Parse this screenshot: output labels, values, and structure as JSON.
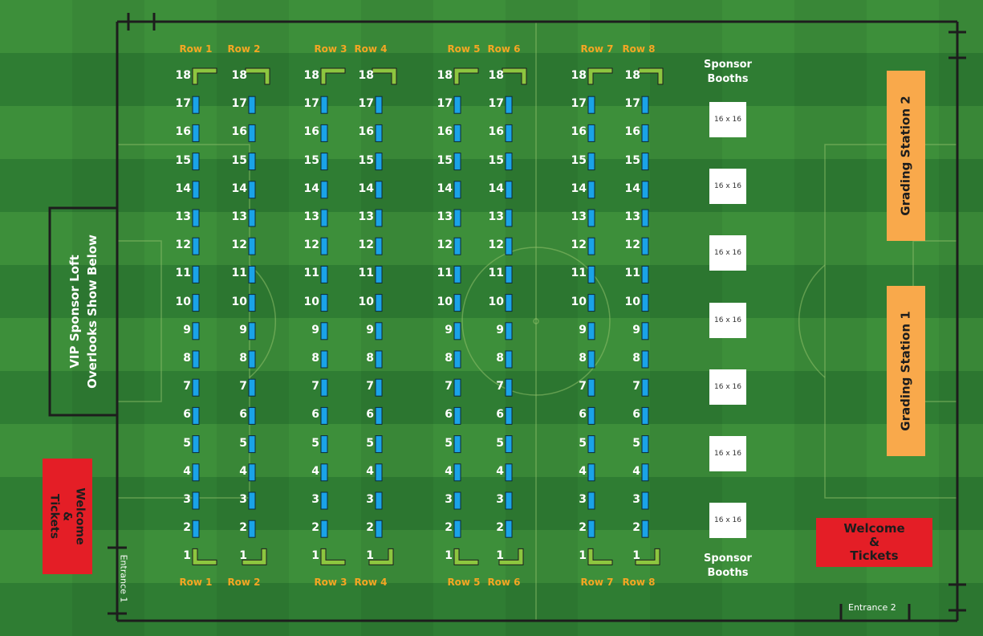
{
  "colors": {
    "grass_dark": "#2f7d33",
    "grass_light": "#3d8f3a",
    "table": "#1aa3e8",
    "corner_table": "#8dc63f",
    "row_label": "#f5a623",
    "grading_station": "#f9a94b",
    "welcome": "#e41e26",
    "booth": "#ffffff",
    "boundary": "#1d1d1d"
  },
  "rows": [
    "Row 1",
    "Row 2",
    "Row 3",
    "Row 4",
    "Row 5",
    "Row 6",
    "Row 7",
    "Row 8"
  ],
  "table_numbers": [
    "18",
    "17",
    "16",
    "15",
    "14",
    "13",
    "12",
    "11",
    "10",
    "9",
    "8",
    "7",
    "6",
    "5",
    "4",
    "3",
    "2",
    "1"
  ],
  "sponsor": {
    "top_label": "Sponsor Booths",
    "bottom_label": "Sponsor Booths",
    "booths": [
      "16 x 16",
      "16 x 16",
      "16 x 16",
      "16 x 16",
      "16 x 16",
      "16 x 16",
      "16 x 16"
    ]
  },
  "grading": {
    "station_2": "Grading Station 2",
    "station_1": "Grading Station 1"
  },
  "vip_loft": {
    "line1": "VIP Sponsor Loft",
    "line2": "Overlooks Show Below"
  },
  "welcome_left": {
    "line1": "Welcome",
    "line2": "&",
    "line3": "Tickets"
  },
  "welcome_right": {
    "line1": "Welcome",
    "line2": "&",
    "line3": "Tickets"
  },
  "entrances": {
    "entrance_1": "Entrance 1",
    "entrance_2": "Entrance 2"
  }
}
